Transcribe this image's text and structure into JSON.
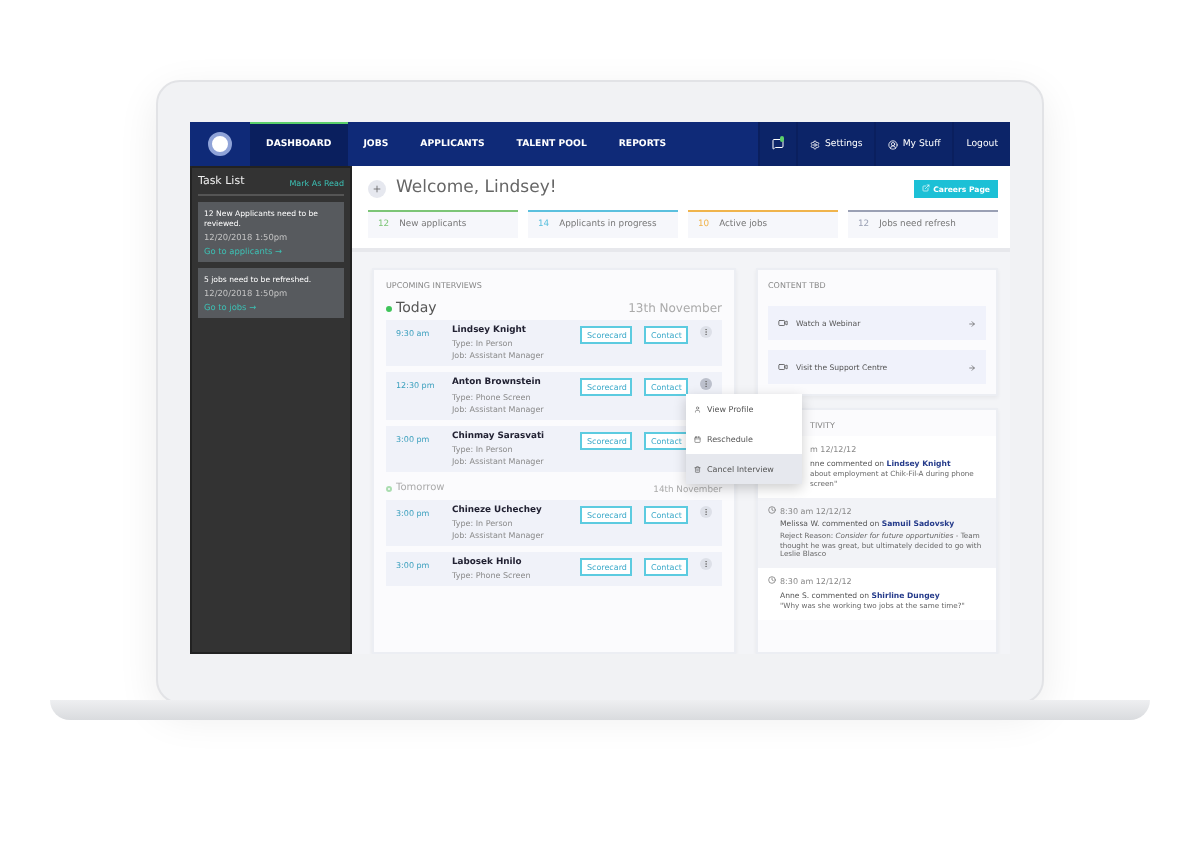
{
  "nav": {
    "items": [
      {
        "label": "DASHBOARD",
        "selected": true
      },
      {
        "label": "JOBS",
        "selected": false
      },
      {
        "label": "APPLICANTS",
        "selected": false
      },
      {
        "label": "TALENT POOL",
        "selected": false
      },
      {
        "label": "REPORTS",
        "selected": false
      }
    ],
    "settings": "Settings",
    "my_stuff": "My Stuff",
    "logout": "Logout",
    "has_notification": true
  },
  "sidebar": {
    "title": "Task List",
    "action": "Mark As Read",
    "tasks": [
      {
        "text": "12 New Applicants need to be reviewed.",
        "time": "12/20/2018 1:50pm",
        "link": "Go to applicants →"
      },
      {
        "text": "5 jobs need to be refreshed.",
        "time": "12/20/2018 1:50pm",
        "link": "Go to jobs →"
      }
    ]
  },
  "welcome": "Welcome, Lindsey!",
  "careers_button": "Careers Page",
  "stats": [
    {
      "count": "12",
      "label": "New applicants",
      "color": "#7cc576"
    },
    {
      "count": "14",
      "label": "Applicants in progress",
      "color": "#5bc0de"
    },
    {
      "count": "10",
      "label": "Active jobs",
      "color": "#f0b44c"
    },
    {
      "count": "12",
      "label": "Jobs need refresh",
      "color": "#9aa0b4"
    }
  ],
  "interviews": {
    "title": "UPCOMING INTERVIEWS",
    "groups": [
      {
        "day": "Today",
        "date": "13th November",
        "current": true,
        "rows": [
          {
            "time": "9:30 am",
            "name": "Lindsey Knight",
            "fields": [
              {
                "label": "Type:",
                "value": "In Person"
              },
              {
                "label": "Job:",
                "value": "Assistant Manager"
              }
            ],
            "buttons": [
              "Scorecard",
              "Contact"
            ],
            "menu_open": false
          },
          {
            "time": "12:30 pm",
            "name": "Anton Brownstein",
            "fields": [
              {
                "label": "Type:",
                "value": "Phone Screen"
              },
              {
                "label": "Job:",
                "value": "Assistant Manager"
              }
            ],
            "buttons": [
              "Scorecard",
              "Contact"
            ],
            "menu_open": true
          },
          {
            "time": "3:00 pm",
            "name": "Chinmay Sarasvati",
            "fields": [
              {
                "label": "Type:",
                "value": "In Person"
              },
              {
                "label": "Job:",
                "value": "Assistant Manager"
              }
            ],
            "buttons": [
              "Scorecard",
              "Contact"
            ],
            "more_visible": false
          }
        ]
      },
      {
        "day": "Tomorrow",
        "date": "14th November",
        "current": false,
        "rows": [
          {
            "time": "3:00 pm",
            "name": "Chineze Uchechey",
            "fields": [
              {
                "label": "Type:",
                "value": "In Person"
              },
              {
                "label": "Job:",
                "value": "Assistant Manager"
              }
            ],
            "buttons": [
              "Scorecard",
              "Contact"
            ],
            "menu_open": false
          },
          {
            "time": "3:00 pm",
            "name": "Labosek Hnilo",
            "fields": [
              {
                "label": "Type:",
                "value": "Phone Screen"
              }
            ],
            "buttons": [
              "Scorecard",
              "Contact"
            ],
            "menu_open": false
          }
        ]
      }
    ]
  },
  "row_menu": [
    {
      "kind": "profile",
      "label": "View Profile",
      "selected": false
    },
    {
      "kind": "reschedule",
      "label": "Reschedule",
      "selected": false
    },
    {
      "kind": "cancel",
      "label": "Cancel Interview",
      "selected": true
    }
  ],
  "content": {
    "title": "CONTENT TBD",
    "links": [
      {
        "label": "Watch a Webinar"
      },
      {
        "label": "Visit the Support Centre"
      }
    ]
  },
  "activity": {
    "title": "TIVITY",
    "items": [
      {
        "time": "m 12/12/12",
        "author": "nne commented on ",
        "subject": "Lindsey Knight",
        "note": "about employment at Chik-Fil-A during phone screen\""
      },
      {
        "time": "8:30 am 12/12/12",
        "author": "Melissa W. commented on ",
        "subject": "Samuil Sadovsky",
        "note": "Reject Reason: *Consider for future opportunities* - Team thought he was great, but ultimately decided to go with Leslie Blasco"
      },
      {
        "time": "8:30 am 12/12/12",
        "author": "Anne S. commented on ",
        "subject": "Shirline Dungey",
        "note": "\"Why was she working two jobs at the same time?\""
      }
    ]
  }
}
